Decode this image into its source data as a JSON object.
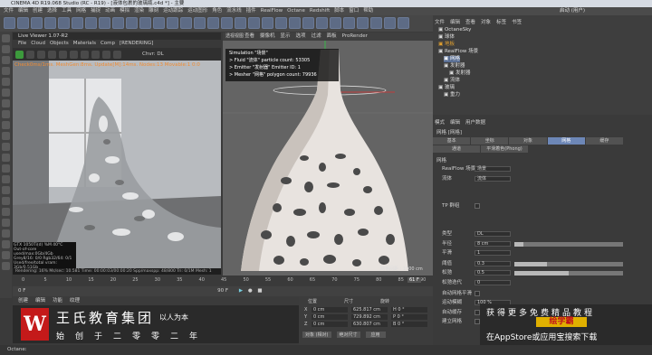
{
  "window_title": "CINEMA 4D R19.068 Studio (RC - R19) - [液体包裹的玻璃瓶.c4d *] - 主要",
  "menubar": [
    "文件",
    "编辑",
    "创建",
    "选择",
    "工具",
    "网格",
    "捕捉",
    "动画",
    "模拟",
    "渲染",
    "雕刻",
    "运动跟踪",
    "运动图形",
    "角色",
    "流水线",
    "插件",
    "RealFlow",
    "Octane",
    "Redshift",
    "脚本",
    "窗口",
    "帮助"
  ],
  "layout_label": "启动 (用户)",
  "live_viewer": {
    "title": "Live Viewer 1.07-R2",
    "menu": [
      "File",
      "Cloud",
      "Objects",
      "Materials",
      "Comp",
      "[RENDERING]"
    ],
    "chvr_label": "Chvr: DL",
    "stats": "Check0ms/1ms. MeshGen:8ms. Update[M]:14ms. Nodes:13 Movable:1 0:0",
    "gpu_info": [
      "GTX 1050Ti(d)   %M   40°C",
      "Out-of-core used/max:0Gb/4Gb",
      "Grey8/16: 0/0   Rgb32/64: 0/1",
      "Used/free/total vram: 3Gb/0.51Gb"
    ],
    "status": "Rendering: 16%  Ms/sec: 10.581  Time: 00:00:03/00:00:20  Spp/maxspp: 48/800  Tri: 0/1M  Mesh: 1"
  },
  "viewport": {
    "tabs": [
      "查看",
      "摄像机",
      "显示",
      "选项",
      "过滤",
      "面板",
      "ProRender"
    ],
    "header_label": "透视视图",
    "sim_title": "Simulation \"场景\"",
    "sim_lines": [
      "> Fluid \"流体\" particle count: 53305",
      "> Emitter \"发射器\" Emitter ID: 1",
      "> Mesher \"网格\" polygon count: 79936"
    ],
    "grid_info": "网格间距 : 1000 cm"
  },
  "timeline": {
    "ticks": [
      "0",
      "5",
      "10",
      "15",
      "20",
      "25",
      "30",
      "35",
      "40",
      "45",
      "50",
      "55",
      "60",
      "65",
      "70",
      "75",
      "80",
      "85",
      "90"
    ],
    "current_frame": "61 F",
    "start": "0 F",
    "end": "90 F"
  },
  "object_manager": {
    "tabs": [
      "文件",
      "编辑",
      "查看",
      "对象",
      "标签",
      "书签"
    ],
    "items": [
      "OctaneSky",
      "球体",
      "地板",
      "RealFlow 场景",
      "网格",
      "发射器",
      "发射器",
      "流体",
      "玻璃",
      "重力"
    ]
  },
  "attribute_manager": {
    "tabs": [
      "模式",
      "编辑",
      "用户数据"
    ],
    "object_label": "网格 [网格]",
    "subtabs": [
      "基本",
      "坐标",
      "对象",
      "网格",
      "缓存"
    ],
    "subtabs2": [
      "通道",
      "平滑着色(Phong)"
    ],
    "section": "网格",
    "props": [
      {
        "label": "RealFlow 场景",
        "value": "场景"
      },
      {
        "label": "流体",
        "value": "流体"
      },
      {
        "label": "TP 群组",
        "value": ""
      },
      {
        "label": "类型",
        "value": "DL"
      },
      {
        "label": "半径",
        "value": "8 cm"
      },
      {
        "label": "平滑",
        "value": "1"
      },
      {
        "label": "阈值",
        "value": "0.3"
      },
      {
        "label": "松弛",
        "value": "0.5"
      },
      {
        "label": "松弛迭代",
        "value": "0"
      },
      {
        "label": "自动网格平滑",
        "value": ""
      },
      {
        "label": "运动模糊",
        "value": "100 %"
      },
      {
        "label": "自动缓存",
        "value": ""
      },
      {
        "label": "建立网格",
        "value": ""
      }
    ]
  },
  "coordinates": {
    "headers": [
      "位置",
      "尺寸",
      "旋转"
    ],
    "rows": [
      {
        "axis": "X",
        "pos": "0 cm",
        "size": "625.817 cm",
        "rot": "H 0 °"
      },
      {
        "axis": "Y",
        "pos": "0 cm",
        "size": "729.892 cm",
        "rot": "P 0 °"
      },
      {
        "axis": "Z",
        "pos": "0 cm",
        "size": "630.807 cm",
        "rot": "B 0 °"
      }
    ],
    "mode": "对象 (相对)",
    "size_mode": "绝对尺寸",
    "apply": "应用"
  },
  "materials_menu": [
    "创建",
    "编辑",
    "功能",
    "纹理"
  ],
  "banner": {
    "logo": "W",
    "brand": "王氏教育集团",
    "tagline": "以人为本",
    "founded": "始创于二零零二年"
  },
  "promo": {
    "line1": "获得更多免费精品教程",
    "badge": "绘学霸",
    "line2": "在AppStore或应用宝搜索下载"
  },
  "statusbar": "Octane:"
}
